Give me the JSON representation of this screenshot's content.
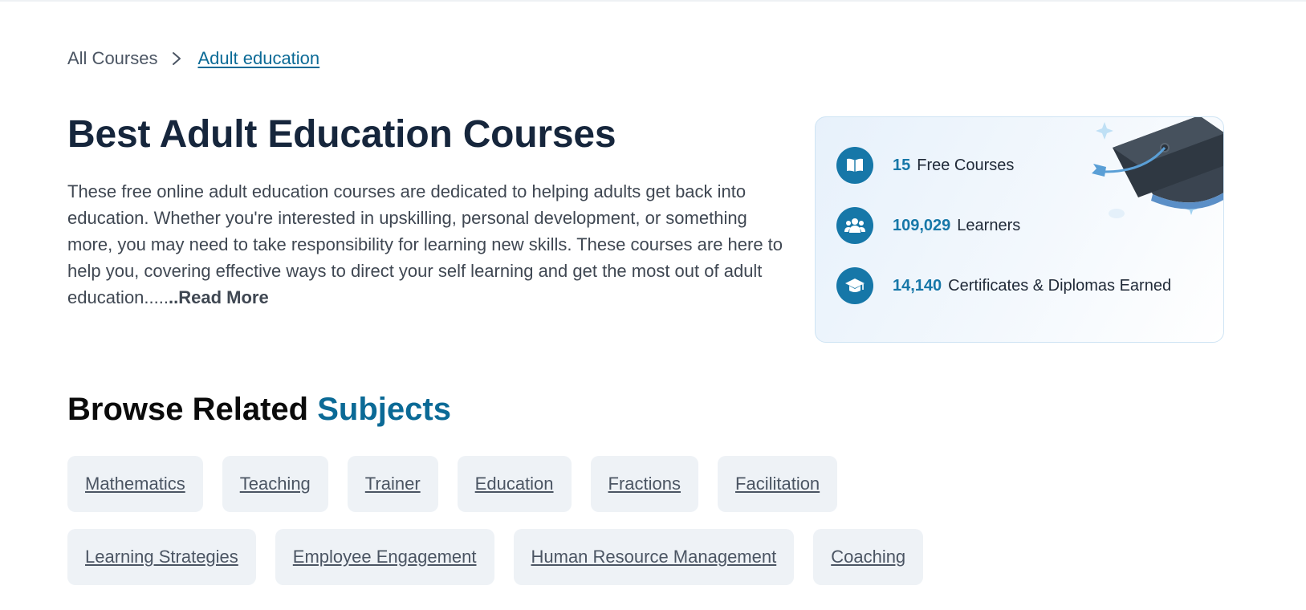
{
  "breadcrumb": {
    "root": "All Courses",
    "current": "Adult education"
  },
  "page": {
    "title": "Best Adult Education Courses",
    "description": "These free online adult education courses are dedicated to helping adults get back into education. Whether you're interested in upskilling, personal development, or something more, you may need to take responsibility for learning new skills. These courses are here to help you, covering effective ways to direct your self learning and get the most out of adult education.....",
    "read_more": "..Read More"
  },
  "stats": {
    "free_courses": {
      "value": "15",
      "label": "Free Courses",
      "icon": "open-book-icon"
    },
    "learners": {
      "value": "109,029",
      "label": "Learners",
      "icon": "people-group-icon"
    },
    "certificates": {
      "value": "14,140",
      "label": "Certificates & Diplomas Earned",
      "icon": "graduation-cap-icon"
    },
    "accent_color": "#1677a8"
  },
  "subjects": {
    "heading_prefix": "Browse Related",
    "heading_accent": "Subjects",
    "row1": [
      "Mathematics",
      "Teaching",
      "Trainer",
      "Education",
      "Fractions",
      "Facilitation"
    ],
    "row2": [
      "Learning Strategies",
      "Employee Engagement",
      "Human Resource Management",
      "Coaching"
    ]
  }
}
